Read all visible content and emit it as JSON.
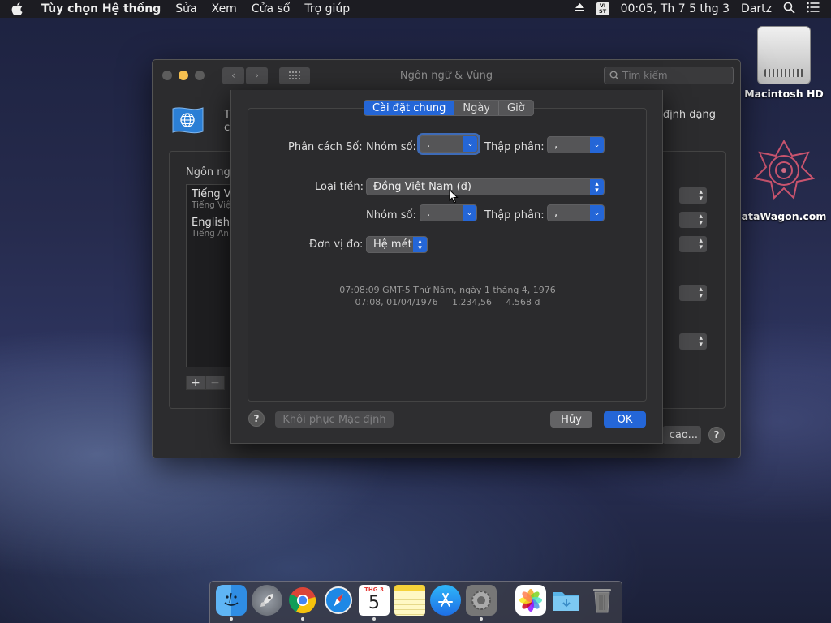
{
  "menubar": {
    "app_name": "Tùy chọn Hệ thống",
    "items": [
      "Sửa",
      "Xem",
      "Cửa sổ",
      "Trợ giúp"
    ],
    "input_source": "VI\nST",
    "clock": "00:05, Th 7 5 thg 3",
    "user": "Dartz"
  },
  "desktop": {
    "hd_label": "Macintosh HD",
    "dw_label": "ataWagon.com"
  },
  "window": {
    "title": "Ngôn ngữ & Vùng",
    "search_placeholder": "Tìm kiếm",
    "header_left_line1": "T",
    "header_left_line2": "c",
    "header_right": "định dạng",
    "panel_label": "Ngôn ngữ",
    "languages": [
      {
        "name": "Tiếng V",
        "sub": "Tiếng Việ"
      },
      {
        "name": "English",
        "sub": "Tiếng An"
      }
    ],
    "add_label": "+",
    "remove_label": "−",
    "advanced_label": "cao...",
    "help_label": "?"
  },
  "sheet": {
    "tabs": [
      {
        "label": "Cài đặt chung",
        "active": true
      },
      {
        "label": "Ngày",
        "active": false
      },
      {
        "label": "Giờ",
        "active": false
      }
    ],
    "number_separators_label": "Phân cách Số:",
    "grouping_label": "Nhóm số:",
    "grouping_value": ".",
    "decimal_label": "Thập phân:",
    "decimal_value": ",",
    "currency_label": "Loại tiền:",
    "currency_value": "Đồng Việt Nam (đ)",
    "currency_grouping_label": "Nhóm số:",
    "currency_grouping_value": ".",
    "currency_decimal_label": "Thập phân:",
    "currency_decimal_value": ",",
    "measure_label": "Đơn vị đo:",
    "measure_value": "Hệ mét",
    "sample_line1": "07:08:09 GMT-5 Thứ Năm, ngày 1 tháng 4, 1976",
    "sample_line2": "07:08, 01/04/1976     1.234,56     4.568 đ",
    "help_label": "?",
    "restore_label": "Khôi phục Mặc định",
    "cancel_label": "Hủy",
    "ok_label": "OK"
  },
  "dock": {
    "calendar_month": "THG 3",
    "calendar_day": "5"
  },
  "colors": {
    "accent": "#2466d7",
    "traffic_yellow": "#f5bf4f"
  }
}
